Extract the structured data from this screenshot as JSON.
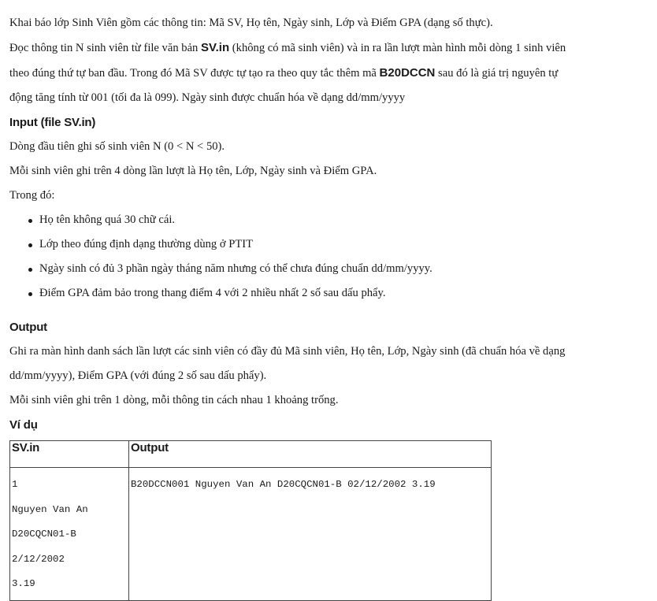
{
  "intro": {
    "line1": "Khai báo lớp Sinh Viên gồm các thông tin: Mã SV, Họ tên, Ngày sinh, Lớp và Điểm GPA (dạng số thực).",
    "line2_a": "Đọc thông tin N sinh viên từ file văn bản ",
    "line2_file": "SV.in",
    "line2_b": " (không có mã sinh viên) và in ra lần lượt màn hình mỗi dòng 1 sinh viên",
    "line3_a": "theo đúng thứ tự ban đầu. Trong đó Mã SV được tự tạo ra theo quy tắc thêm mã ",
    "line3_code": "B20DCCN",
    "line3_b": " sau đó là giá trị nguyên tự",
    "line4": "động tăng tính từ 001 (tối đa là 099). Ngày sinh được chuẩn hóa về dạng dd/mm/yyyy"
  },
  "input": {
    "heading": "Input (file SV.in)",
    "lines": [
      "Dòng đầu tiên ghi số sinh viên N (0 < N < 50).",
      "Mỗi sinh viên ghi trên 4 dòng lần lượt là Họ tên, Lớp, Ngày sinh và Điểm GPA.",
      "Trong đó:"
    ],
    "bullets": [
      "Họ tên không quá 30 chữ cái.",
      "Lớp theo đúng định dạng thường dùng ở PTIT",
      "Ngày sinh có đủ 3 phần ngày tháng năm nhưng có thể chưa đúng chuẩn dd/mm/yyyy.",
      "Điểm GPA đảm bảo trong thang điểm 4 với 2 nhiều nhất 2 số sau dấu phẩy."
    ]
  },
  "output": {
    "heading": "Output",
    "lines": [
      "Ghi ra màn hình danh sách lần lượt các sinh viên có đầy đủ Mã sinh viên, Họ tên, Lớp, Ngày sinh (đã chuẩn hóa về dạng",
      "dd/mm/yyyy), Điểm GPA (với đúng 2 số sau dấu phẩy).",
      "Mỗi sinh viên ghi trên 1 dòng, mỗi thông tin cách nhau 1 khoảng trống."
    ]
  },
  "example": {
    "heading": "Ví dụ",
    "col_input": "SV.in",
    "col_output": "Output",
    "input_lines": [
      "1",
      "Nguyen Van An",
      "D20CQCN01-B",
      "2/12/2002",
      "3.19"
    ],
    "output_lines": [
      "B20DCCN001 Nguyen Van An D20CQCN01-B 02/12/2002 3.19"
    ]
  }
}
